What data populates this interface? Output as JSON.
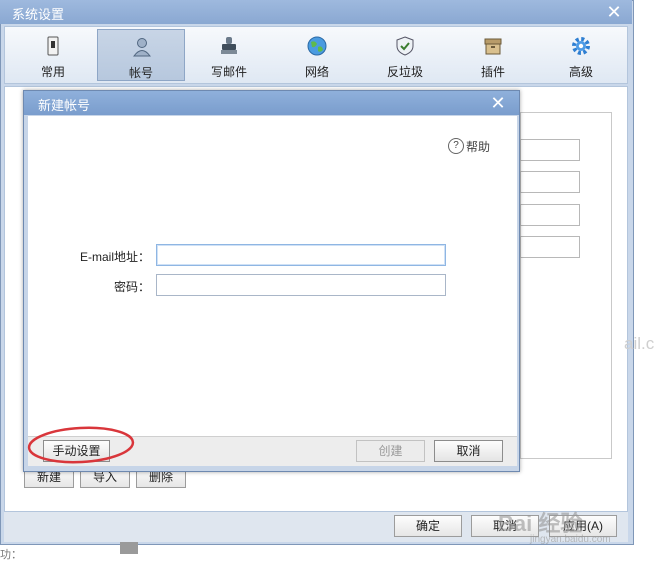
{
  "settings_window": {
    "title": "系统设置",
    "close_glyph": "✕",
    "toolbar": [
      {
        "label": "常用",
        "icon": "phone-icon",
        "active": false
      },
      {
        "label": "帐号",
        "icon": "user-icon",
        "active": true
      },
      {
        "label": "写邮件",
        "icon": "stamp-icon",
        "active": false
      },
      {
        "label": "网络",
        "icon": "globe-icon",
        "active": false
      },
      {
        "label": "反垃圾",
        "icon": "shield-icon",
        "active": false
      },
      {
        "label": "插件",
        "icon": "box-icon",
        "active": false
      },
      {
        "label": "高级",
        "icon": "gear-icon",
        "active": false
      }
    ],
    "account_buttons": {
      "new": "新建",
      "import": "导入",
      "delete": "删除"
    },
    "footer_buttons": {
      "ok": "确定",
      "cancel": "取消",
      "apply": "应用(A)"
    },
    "background_text_fragment": "ail.c",
    "left_fragment": "功："
  },
  "dialog": {
    "title": "新建帐号",
    "close_glyph": "✕",
    "help_label": "帮助",
    "help_glyph": "?",
    "email_label": "E-mail地址：",
    "email_value": "",
    "password_label": "密码：",
    "password_value": "",
    "manual_button": "手动设置",
    "create_button": "创建",
    "cancel_button": "取消"
  },
  "watermark": {
    "main": "Bai 经验",
    "sub": "jingyan.baidu.com"
  },
  "colors": {
    "title_bar": "#8aa8d2",
    "highlight_circle": "#d9363b",
    "accent_active": "#b7c8de"
  }
}
